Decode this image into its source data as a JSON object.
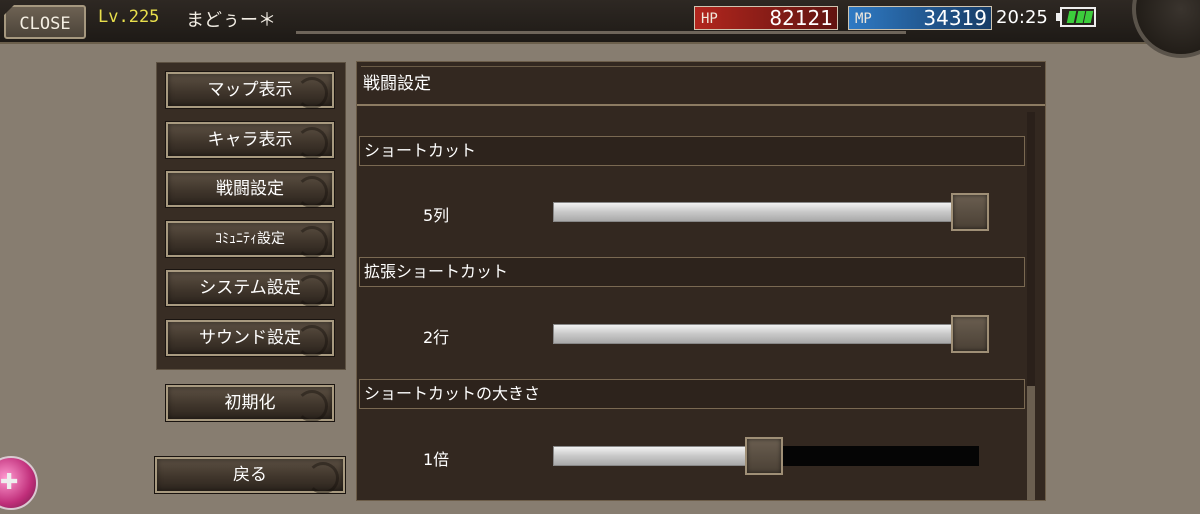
{
  "topbar": {
    "close_label": "CLOSE",
    "level": "Lv.225",
    "player_name": "まどぅー＊",
    "hp_label": "HP",
    "hp_value": "82121",
    "mp_label": "MP",
    "mp_value": "34319",
    "time": "20:25"
  },
  "menu": {
    "items": [
      {
        "label": "マップ表示"
      },
      {
        "label": "キャラ表示"
      },
      {
        "label": "戦闘設定"
      },
      {
        "label": "ｺﾐｭﾆﾃｨ設定"
      },
      {
        "label": "システム設定"
      },
      {
        "label": "サウンド設定"
      }
    ],
    "reset_label": "初期化",
    "back_label": "戻る"
  },
  "panel": {
    "title": "戦闘設定",
    "sections": [
      {
        "heading": "ショートカット",
        "value_text": "5列",
        "fraction": 1.0
      },
      {
        "heading": "拡張ショートカット",
        "value_text": "2行",
        "fraction": 1.0
      },
      {
        "heading": "ショートカットの大きさ",
        "value_text": "1倍",
        "fraction": 0.5
      }
    ]
  },
  "colors": {
    "hp": "#b2261e",
    "mp": "#2f7ac4",
    "level": "#e8df4c",
    "battery": "#3ccd3c"
  }
}
